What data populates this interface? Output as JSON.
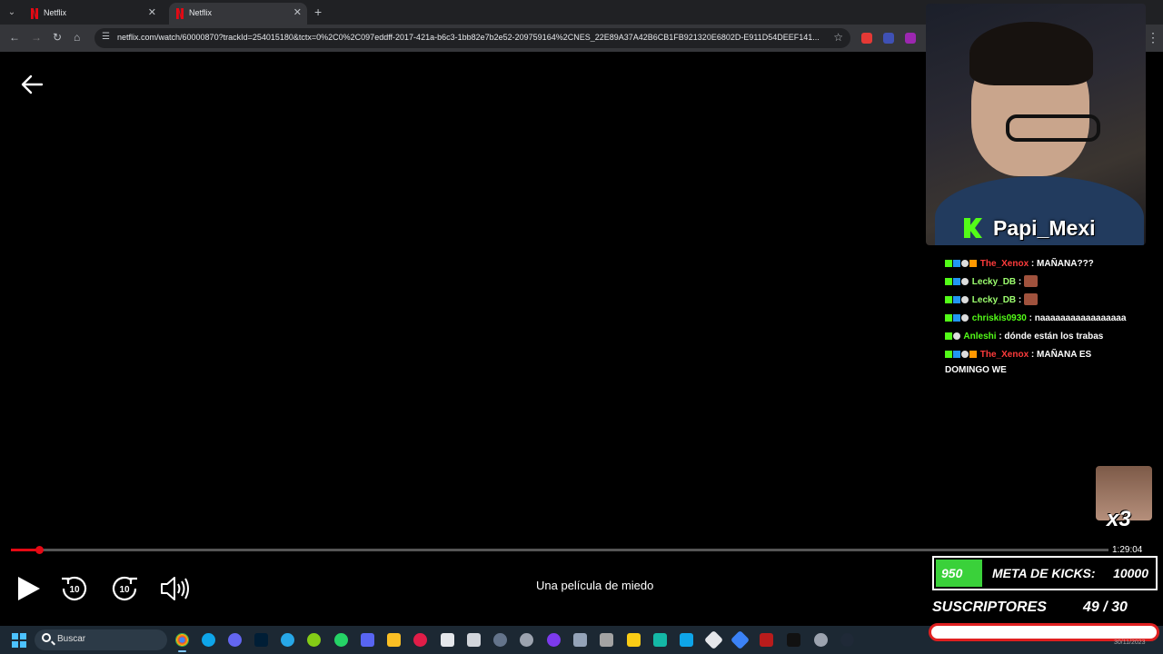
{
  "browser": {
    "tabs": [
      {
        "title": "Netflix",
        "active": false
      },
      {
        "title": "Netflix",
        "active": true
      }
    ],
    "url": "netflix.com/watch/60000870?trackId=254015180&tctx=0%2C0%2C097eddff-2017-421a-b6c3-1bb82e7b2e52-209759164%2CNES_22E89A37A42B6CB1FB921320E6802D-E911D54DEEF141..."
  },
  "player": {
    "time_remaining": "1:29:04",
    "progress_fraction": 0.026,
    "title": "Una película de miedo"
  },
  "stream": {
    "streamer_name": "Papi_Mexi",
    "chat": [
      {
        "user": "The_Xenox",
        "user_color": "red",
        "text": ": MAÑANA???"
      },
      {
        "user": "Lecky_DB",
        "user_color": "green",
        "text": ":",
        "emote": true
      },
      {
        "user": "Lecky_DB",
        "user_color": "green",
        "text": ":",
        "emote": true
      },
      {
        "user": "chriskis0930",
        "user_color": "lime",
        "text": ": naaaaaaaaaaaaaaaaa"
      },
      {
        "user": "Anleshi",
        "user_color": "lime",
        "text": ": dónde están los trabas"
      },
      {
        "user": "The_Xenox",
        "user_color": "red",
        "text": ": MAÑANA ES DOMINGO WE"
      }
    ],
    "combo": "x3",
    "kick_goal": {
      "current": "950",
      "label": "META DE KICKS:",
      "target": "10000",
      "fraction": 0.095
    },
    "subs_goal": {
      "label": "SUSCRIPTORES",
      "count": "49 / 30"
    }
  },
  "taskbar": {
    "search_label": "Buscar",
    "tray_date": "30/11/2023"
  }
}
